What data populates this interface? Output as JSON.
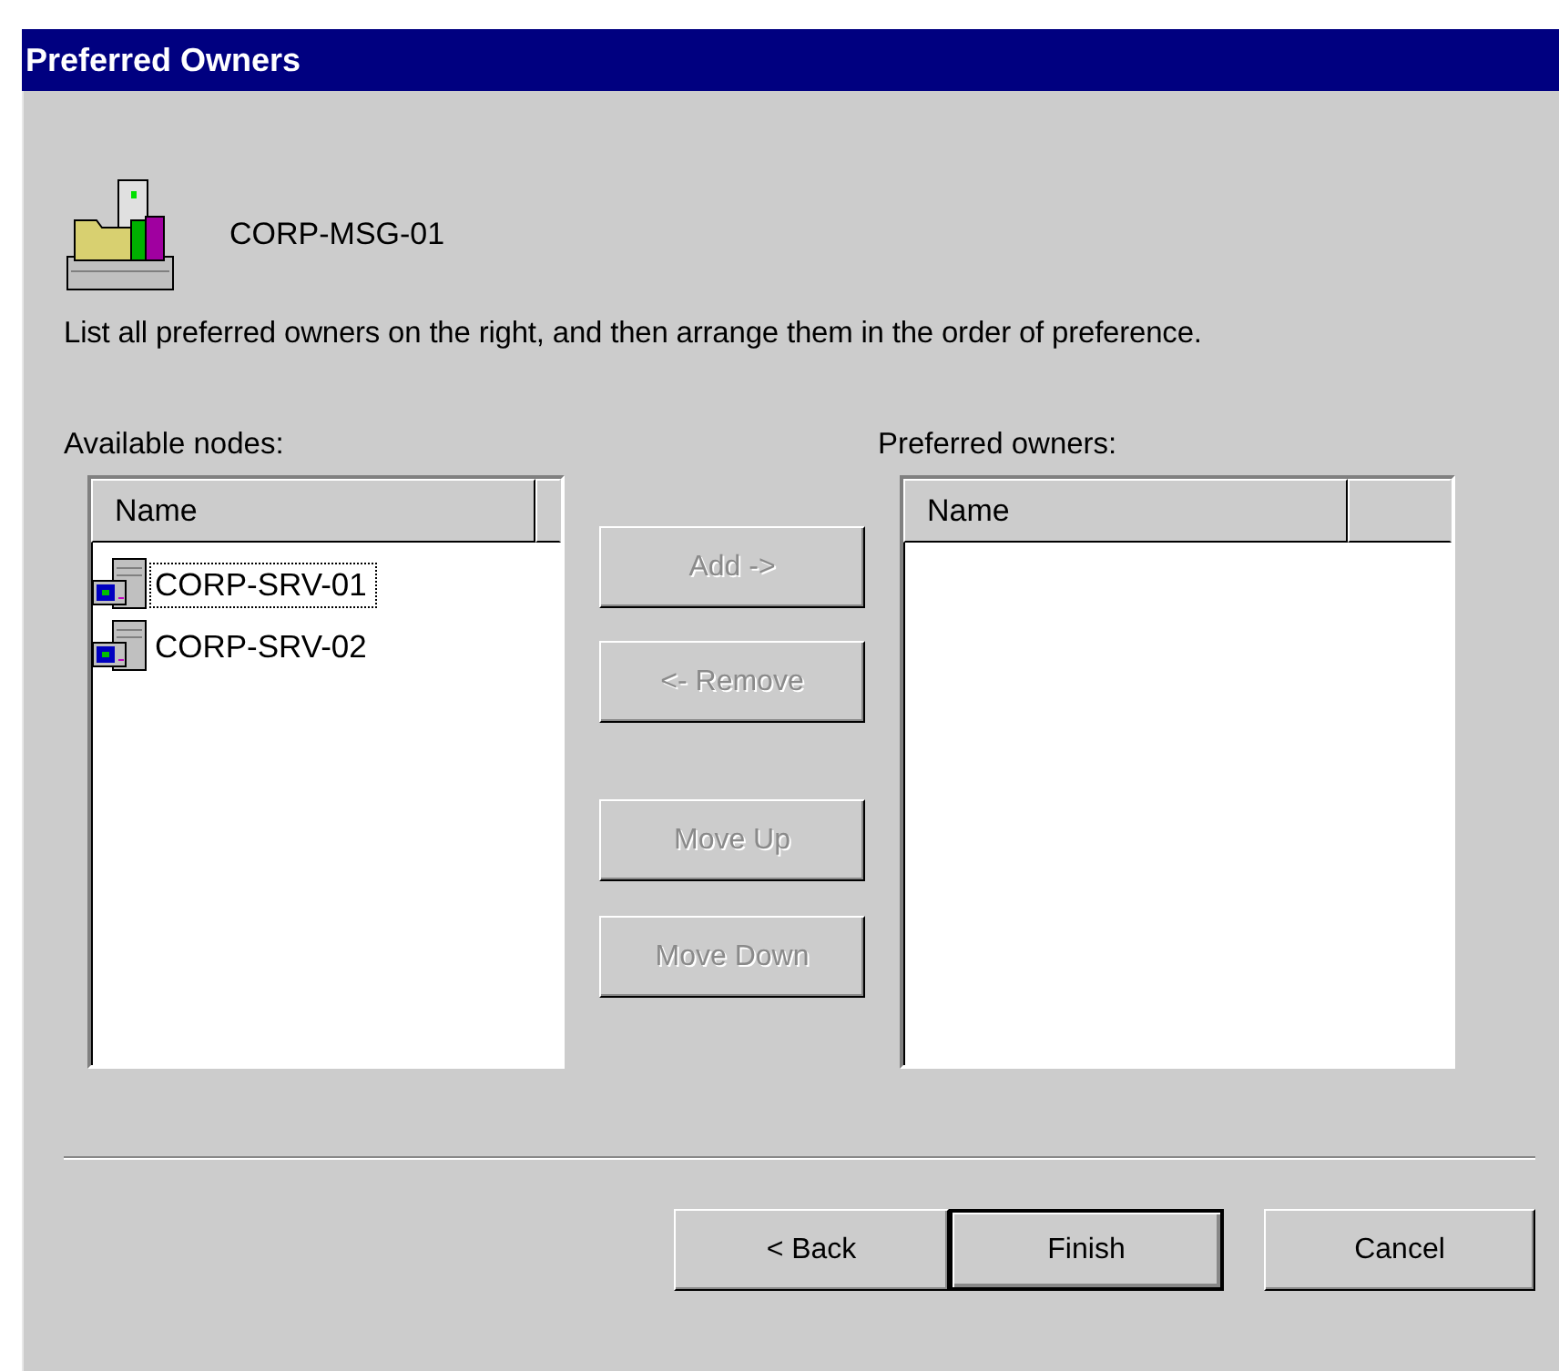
{
  "window": {
    "title": "Preferred Owners"
  },
  "group": {
    "name": "CORP-MSG-01"
  },
  "instructions": "List all preferred owners on the right, and then arrange them in the order of preference.",
  "available_nodes": {
    "label": "Available nodes:",
    "columns": [
      "Name"
    ],
    "rows": [
      {
        "name": "CORP-SRV-01",
        "focused": true
      },
      {
        "name": "CORP-SRV-02",
        "focused": false
      }
    ]
  },
  "move_buttons": [
    {
      "label": "Add ->",
      "disabled": true
    },
    {
      "label": "<- Remove",
      "disabled": true
    },
    {
      "label": "Move Up",
      "disabled": true
    },
    {
      "label": "Move Down",
      "disabled": true
    }
  ],
  "preferred_owners": {
    "label": "Preferred owners:",
    "columns": [
      "Name"
    ]
  },
  "footer_buttons": [
    {
      "label": "< Back",
      "default": false,
      "disabled": false
    },
    {
      "label": "Finish",
      "default": true,
      "disabled": false
    },
    {
      "label": "Cancel",
      "default": false,
      "disabled": false
    }
  ]
}
